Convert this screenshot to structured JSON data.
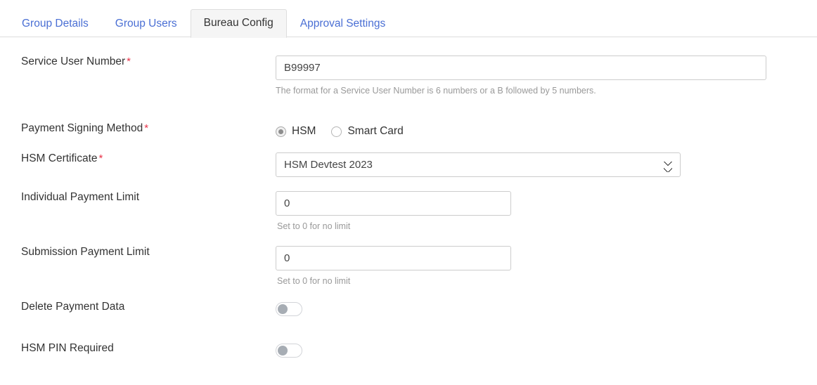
{
  "tabs": [
    {
      "label": "Group Details",
      "active": false
    },
    {
      "label": "Group Users",
      "active": false
    },
    {
      "label": "Bureau Config",
      "active": true
    },
    {
      "label": "Approval Settings",
      "active": false
    }
  ],
  "form": {
    "service_user_number": {
      "label": "Service User Number",
      "required_marker": "*",
      "value": "B99997",
      "help": "The format for a Service User Number is 6 numbers or a B followed by 5 numbers."
    },
    "payment_signing_method": {
      "label": "Payment Signing Method",
      "required_marker": "*",
      "options": [
        {
          "label": "HSM",
          "selected": true
        },
        {
          "label": "Smart Card",
          "selected": false
        }
      ]
    },
    "hsm_certificate": {
      "label": "HSM Certificate",
      "required_marker": "*",
      "value": "HSM Devtest 2023",
      "options": [
        "HSM Devtest 2023"
      ]
    },
    "individual_payment_limit": {
      "label": "Individual Payment Limit",
      "value": "0",
      "help": "Set to 0 for no limit"
    },
    "submission_payment_limit": {
      "label": "Submission Payment Limit",
      "value": "0",
      "help": "Set to 0 for no limit"
    },
    "delete_payment_data": {
      "label": "Delete Payment Data",
      "state": "off"
    },
    "hsm_pin_required": {
      "label": "HSM PIN Required",
      "state": "off"
    }
  },
  "colors": {
    "link": "#4a6fd4",
    "required": "#e8344a",
    "active_tab_bg": "#f5f5f5",
    "border": "#cccccc",
    "help_text": "#999999",
    "toggle_knob": "#a7adb4"
  }
}
